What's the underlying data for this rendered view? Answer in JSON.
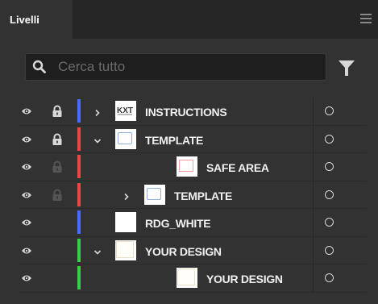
{
  "panel": {
    "tab_label": "Livelli",
    "menu_icon": "hamburger-menu-icon"
  },
  "search": {
    "placeholder": "Cerca tutto",
    "icon": "search-icon",
    "filter_icon": "filter-icon"
  },
  "colors": {
    "blue": "#4a6cff",
    "red": "#e84848",
    "green": "#38d04a"
  },
  "layers": [
    {
      "name": "INSTRUCTIONS",
      "visible": true,
      "locked": true,
      "lock_style": "solid",
      "color": "blue",
      "expand": "collapsed",
      "indent": 0,
      "thumb": "instructions"
    },
    {
      "name": "TEMPLATE",
      "visible": true,
      "locked": true,
      "lock_style": "solid",
      "color": "red",
      "expand": "expanded",
      "indent": 0,
      "thumb": "template"
    },
    {
      "name": "SAFE AREA",
      "visible": true,
      "locked": true,
      "lock_style": "dim",
      "color": "red",
      "expand": "none",
      "indent": 2,
      "thumb": "safe-area"
    },
    {
      "name": "TEMPLATE",
      "visible": true,
      "locked": true,
      "lock_style": "dim",
      "color": "red",
      "expand": "collapsed",
      "indent": 1,
      "thumb": "template"
    },
    {
      "name": "RDG_WHITE",
      "visible": true,
      "locked": false,
      "color": "blue",
      "expand": "none",
      "indent": 0,
      "thumb": "white"
    },
    {
      "name": "YOUR DESIGN",
      "visible": true,
      "locked": false,
      "color": "green",
      "expand": "expanded",
      "indent": 0,
      "thumb": "design"
    },
    {
      "name": "YOUR DESIGN",
      "visible": true,
      "locked": false,
      "color": "green",
      "expand": "none",
      "indent": 2,
      "thumb": "design"
    }
  ]
}
